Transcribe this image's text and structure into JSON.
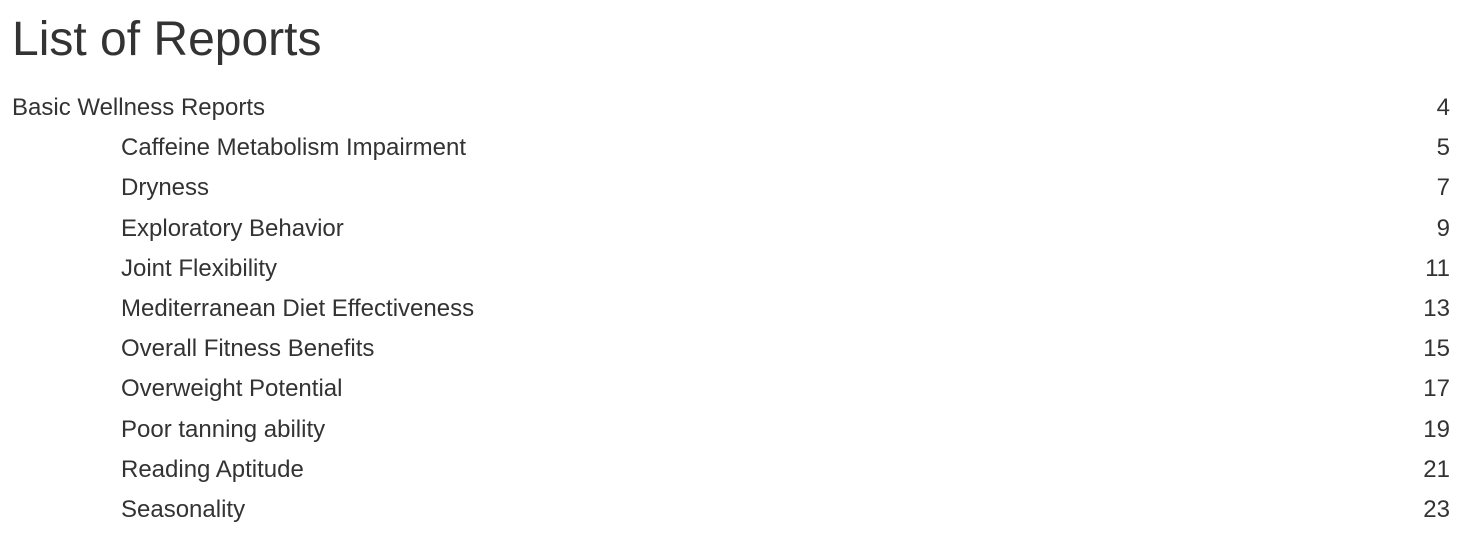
{
  "title": "List of Reports",
  "sections": [
    {
      "label": "Basic Wellness Reports",
      "page": "4",
      "items": [
        {
          "label": "Caffeine Metabolism Impairment",
          "page": "5"
        },
        {
          "label": "Dryness",
          "page": "7"
        },
        {
          "label": "Exploratory Behavior",
          "page": "9"
        },
        {
          "label": "Joint Flexibility",
          "page": "11"
        },
        {
          "label": "Mediterranean Diet Effectiveness",
          "page": "13"
        },
        {
          "label": "Overall Fitness Benefits",
          "page": "15"
        },
        {
          "label": "Overweight Potential",
          "page": "17"
        },
        {
          "label": "Poor tanning ability",
          "page": "19"
        },
        {
          "label": "Reading Aptitude",
          "page": "21"
        },
        {
          "label": "Seasonality",
          "page": "23"
        }
      ]
    }
  ]
}
